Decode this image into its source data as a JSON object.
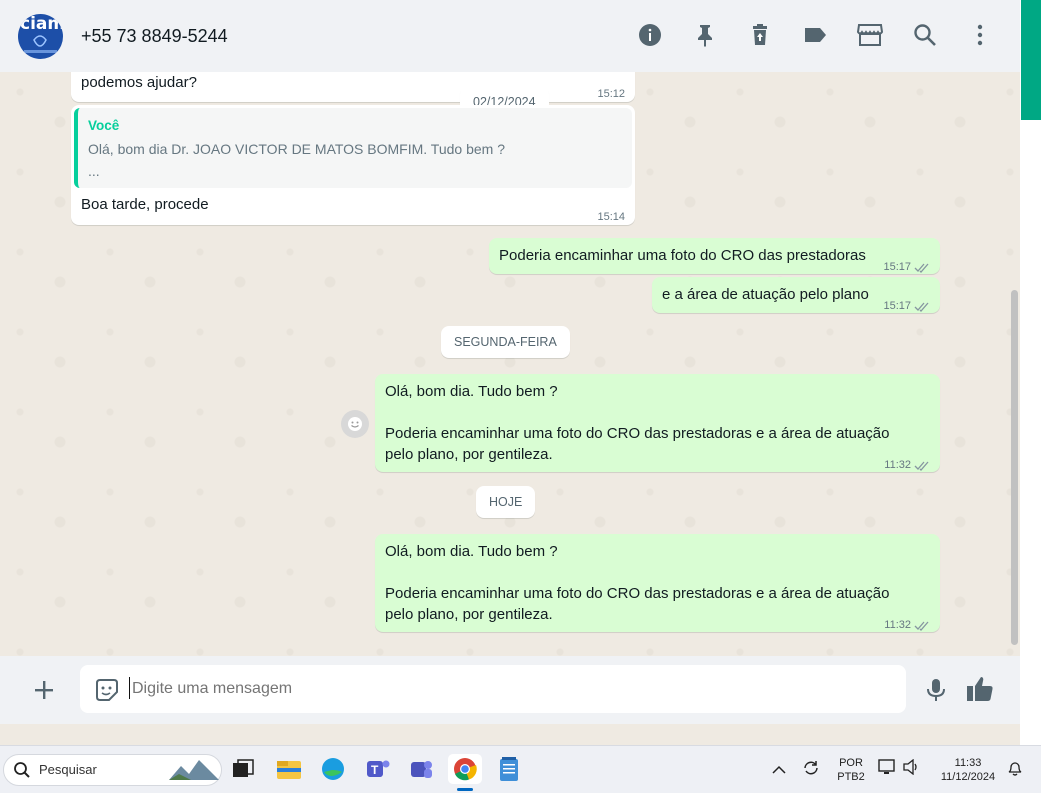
{
  "header": {
    "avatar_text": "ciam",
    "contact_name": "+55 73 8849-5244",
    "icons": [
      "info-icon",
      "pin-icon",
      "delete-icon",
      "label-icon",
      "catalog-icon",
      "search-icon",
      "menu-icon"
    ]
  },
  "messages": {
    "m1_text": "podemos ajudar?",
    "m1_time": "15:12",
    "chip1": "02/12/2024",
    "m2_quote_author": "Você",
    "m2_quote_line1": "Olá, bom dia Dr. JOAO VICTOR DE MATOS BOMFIM. Tudo bem ?",
    "m2_quote_line2": "...",
    "m2_text": "Boa tarde, procede",
    "m2_time": "15:14",
    "m3_text": "Poderia encaminhar uma foto do CRO das prestadoras",
    "m3_time": "15:17",
    "m4_text": "e a área de atuação pelo plano",
    "m4_time": "15:17",
    "chip2": "SEGUNDA-FEIRA",
    "m5_line1": "Olá, bom dia. Tudo bem ?",
    "m5_line2": "Poderia encaminhar uma foto do CRO das prestadoras e a área de atuação",
    "m5_line3": "pelo plano, por gentileza.",
    "m5_time": "11:32",
    "chip3": "HOJE",
    "m6_line1": "Olá, bom dia. Tudo bem ?",
    "m6_line2": "Poderia encaminhar uma foto do CRO das prestadoras e a área de atuação",
    "m6_line3": "pelo plano, por gentileza.",
    "m6_time": "11:32"
  },
  "composer": {
    "placeholder": "Digite uma mensagem"
  },
  "taskbar": {
    "search_label": "Pesquisar",
    "lang_top": "POR",
    "lang_bottom": "PTB2",
    "time": "11:33",
    "date": "11/12/2024"
  },
  "colors": {
    "accent": "#00a884",
    "outgoing": "#d9fdd3",
    "tick": "#8696a0"
  }
}
